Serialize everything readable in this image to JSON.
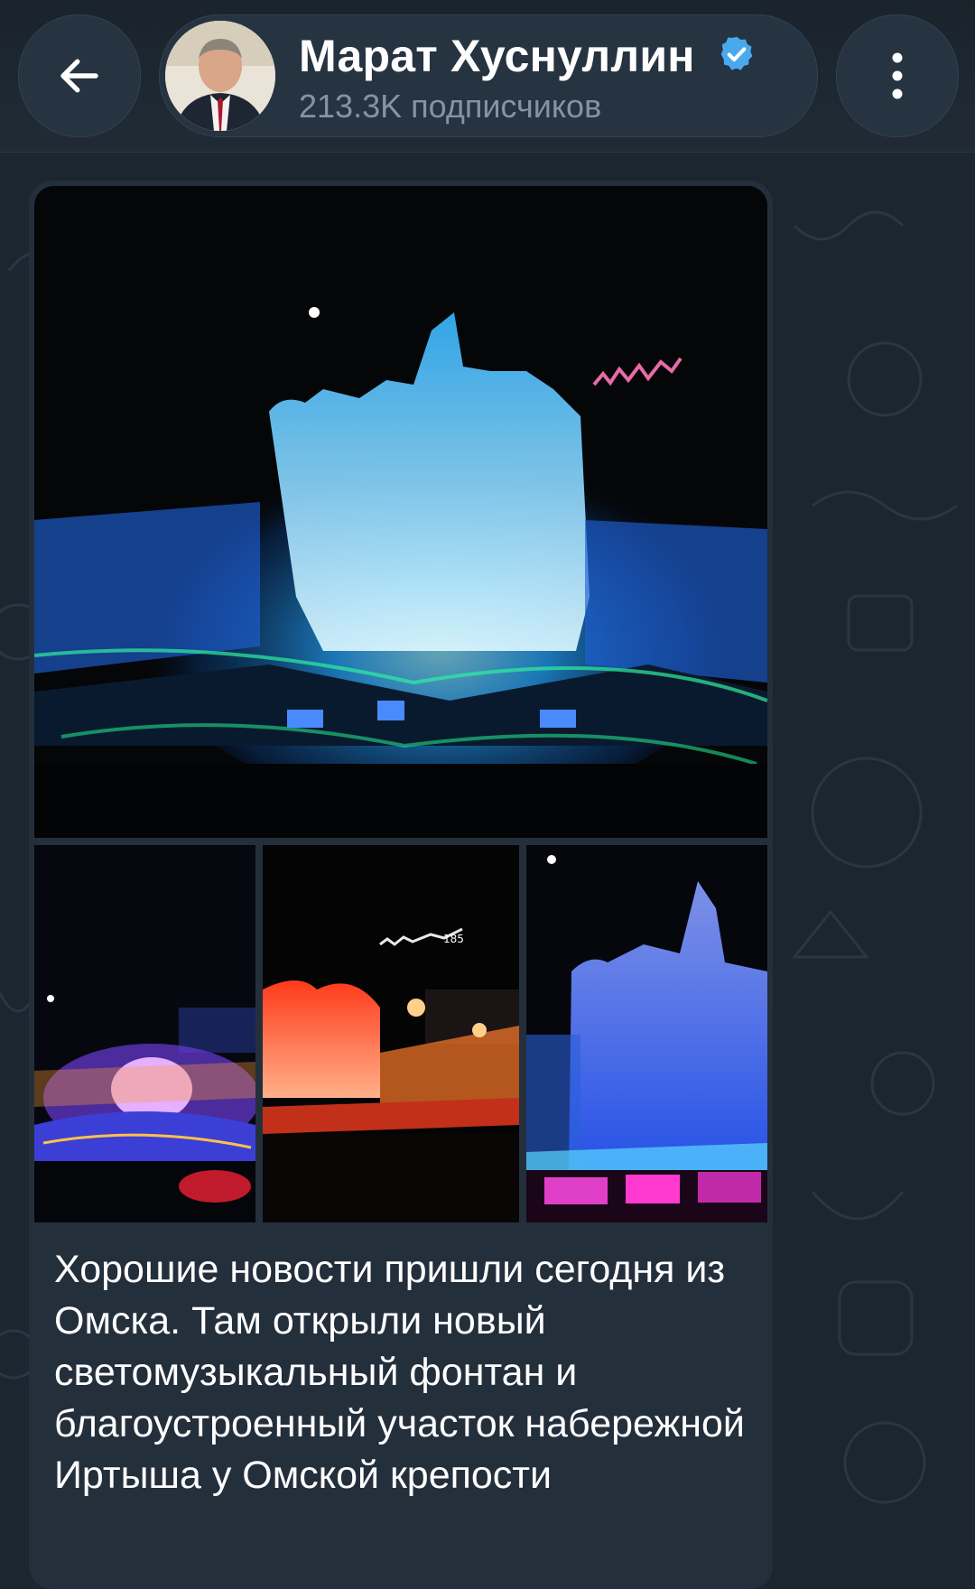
{
  "header": {
    "channel_name": "Марат Хуснуллин",
    "subscribers": "213.3K подписчиков",
    "back_icon": "arrow-left-icon",
    "menu_icon": "more-vertical-icon",
    "verified_icon": "verified-badge-icon",
    "accent": "#4aa8ee"
  },
  "post": {
    "photos": [
      {
        "name": "photo-fountain-blue-wide",
        "dominant": "#1e90ff"
      },
      {
        "name": "photo-fountain-purple-crowd",
        "dominant": "#b070ff"
      },
      {
        "name": "photo-fountain-red-stage",
        "dominant": "#ff4a1e"
      },
      {
        "name": "photo-fountain-blue-close",
        "dominant": "#5a7dff"
      }
    ],
    "caption": "Хорошие новости пришли сегодня из Омска. Там открыли новый светомузыкальный фонтан и благоустроенный участок набережной Иртыша у Омской крепости"
  },
  "colors": {
    "background": "#1c2630",
    "bubble": "#242f3c",
    "secondary_text": "#8594a3"
  }
}
